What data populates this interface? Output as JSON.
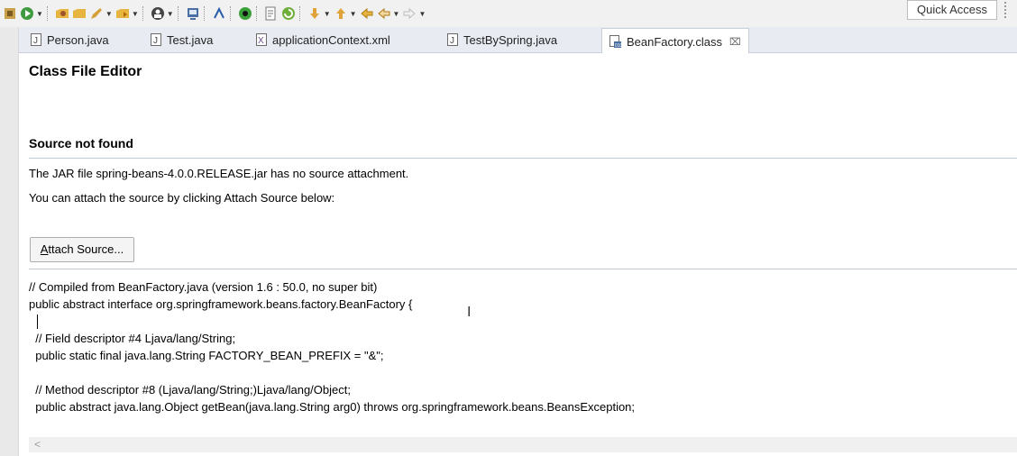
{
  "toolbar": {
    "icons": [
      "new-wizard-icon",
      "run-icon",
      "open-type-icon",
      "open-resource-icon",
      "build-icon",
      "folder-open-icon",
      "debug-icon",
      "task-icon",
      "pen-icon",
      "coverage-icon",
      "package-icon",
      "refresh-icon",
      "next-annotation-icon",
      "prev-annotation-icon",
      "last-edit-icon",
      "back-icon",
      "forward-icon"
    ],
    "quick_access": "Quick Access"
  },
  "tabs": [
    {
      "label": "Person.java",
      "icon": "java-file-icon"
    },
    {
      "label": "Test.java",
      "icon": "java-file-icon"
    },
    {
      "label": "applicationContext.xml",
      "icon": "xml-file-icon"
    },
    {
      "label": "TestBySpring.java",
      "icon": "java-file-icon"
    },
    {
      "label": "BeanFactory.class",
      "icon": "class-file-icon",
      "close": "⌧"
    }
  ],
  "editor": {
    "title": "Class File Editor",
    "section_title": "Source not found",
    "message1": "The JAR file spring-beans-4.0.0.RELEASE.jar has no source attachment.",
    "message2": "You can attach the source by clicking Attach Source below:",
    "attach_button": {
      "mnemonic": "A",
      "rest": "ttach Source..."
    },
    "code_lines": [
      "// Compiled from BeanFactory.java (version 1.6 : 50.0, no super bit)",
      "public abstract interface org.springframework.beans.factory.BeanFactory {",
      "  ",
      "  // Field descriptor #4 Ljava/lang/String;",
      "  public static final java.lang.String FACTORY_BEAN_PREFIX = \"&\";",
      "  ",
      "  // Method descriptor #8 (Ljava/lang/String;)Ljava/lang/Object;",
      "  public abstract java.lang.Object getBean(java.lang.String arg0) throws org.springframework.beans.BeansException;"
    ],
    "scroll_left": "<"
  },
  "colors": {
    "toolbar_bg": "#f1f1f1",
    "tabbar_bg": "#e8ecf2",
    "separator": "#c0c8d2"
  }
}
